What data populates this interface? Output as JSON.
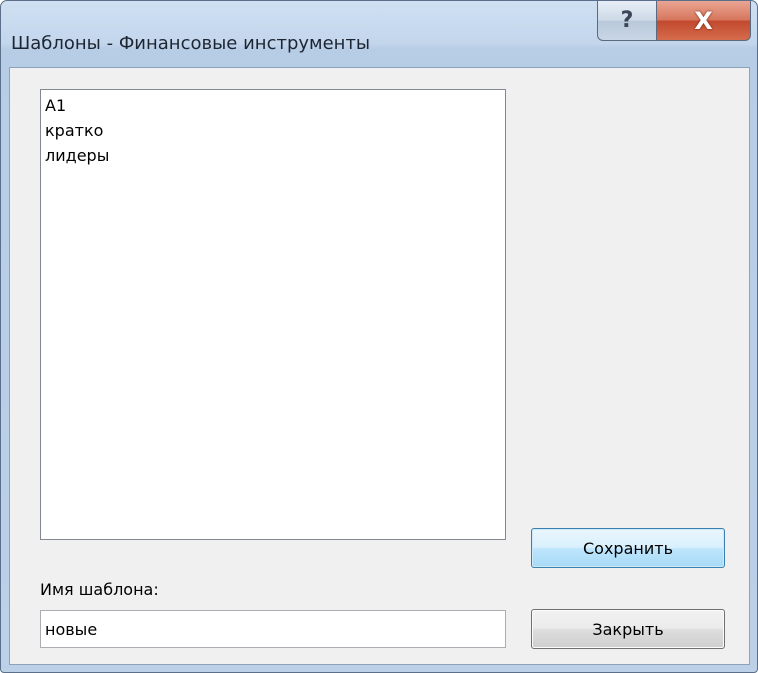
{
  "window": {
    "title": "Шаблоны - Финансовые инструменты",
    "help_glyph": "?",
    "close_glyph": "X"
  },
  "templates": {
    "items": [
      {
        "label": "A1"
      },
      {
        "label": "кратко"
      },
      {
        "label": "лидеры"
      }
    ]
  },
  "name_field": {
    "label": "Имя шаблона:",
    "value": "новые"
  },
  "buttons": {
    "save_label": "Сохранить",
    "close_label": "Закрыть"
  },
  "icons": {
    "help": "help-icon",
    "close": "close-icon"
  },
  "colors": {
    "close_button": "#c14a2e",
    "default_button_border": "#3c7fb1",
    "frame": "#bcd1e8"
  }
}
